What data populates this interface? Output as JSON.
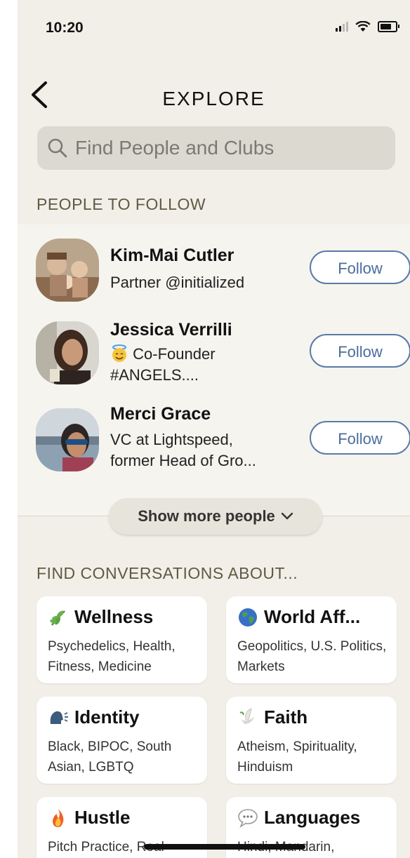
{
  "status": {
    "time": "10:20"
  },
  "header": {
    "title": "EXPLORE"
  },
  "search": {
    "placeholder": "Find People and Clubs"
  },
  "people_section": {
    "label": "PEOPLE TO FOLLOW",
    "people": [
      {
        "name": "Kim-Mai Cutler",
        "bio_line1": "Partner @initialized",
        "bio_line2": "",
        "follow_label": "Follow"
      },
      {
        "name": "Jessica Verrilli",
        "bio_emoji": "😇",
        "bio_line1": "Co-Founder",
        "bio_line2": "#ANGELS....",
        "follow_label": "Follow"
      },
      {
        "name": "Merci Grace",
        "bio_line1": "VC at Lightspeed,",
        "bio_line2": "former Head of Gro...",
        "follow_label": "Follow"
      }
    ],
    "show_more_label": "Show more people"
  },
  "topics_section": {
    "label": "FIND CONVERSATIONS ABOUT...",
    "topics": [
      {
        "title": "Wellness",
        "icon": "herb-icon",
        "desc": "Psychedelics, Health, Fitness, Medicine"
      },
      {
        "title": "World Aff...",
        "icon": "globe-icon",
        "desc": "Geopolitics, U.S. Politics, Markets"
      },
      {
        "title": "Identity",
        "icon": "speaking-head-icon",
        "desc": "Black, BIPOC, South Asian, LGBTQ"
      },
      {
        "title": "Faith",
        "icon": "dove-icon",
        "desc": "Atheism, Spirituality, Hinduism"
      },
      {
        "title": "Hustle",
        "icon": "fire-icon",
        "desc": "Pitch Practice, Real"
      },
      {
        "title": "Languages",
        "icon": "speech-bubble-icon",
        "desc": "Hindi, Mandarin,"
      }
    ]
  },
  "colors": {
    "background": "#f1efe7",
    "accent": "#4a6d9c",
    "section_label": "#5f5a44"
  }
}
